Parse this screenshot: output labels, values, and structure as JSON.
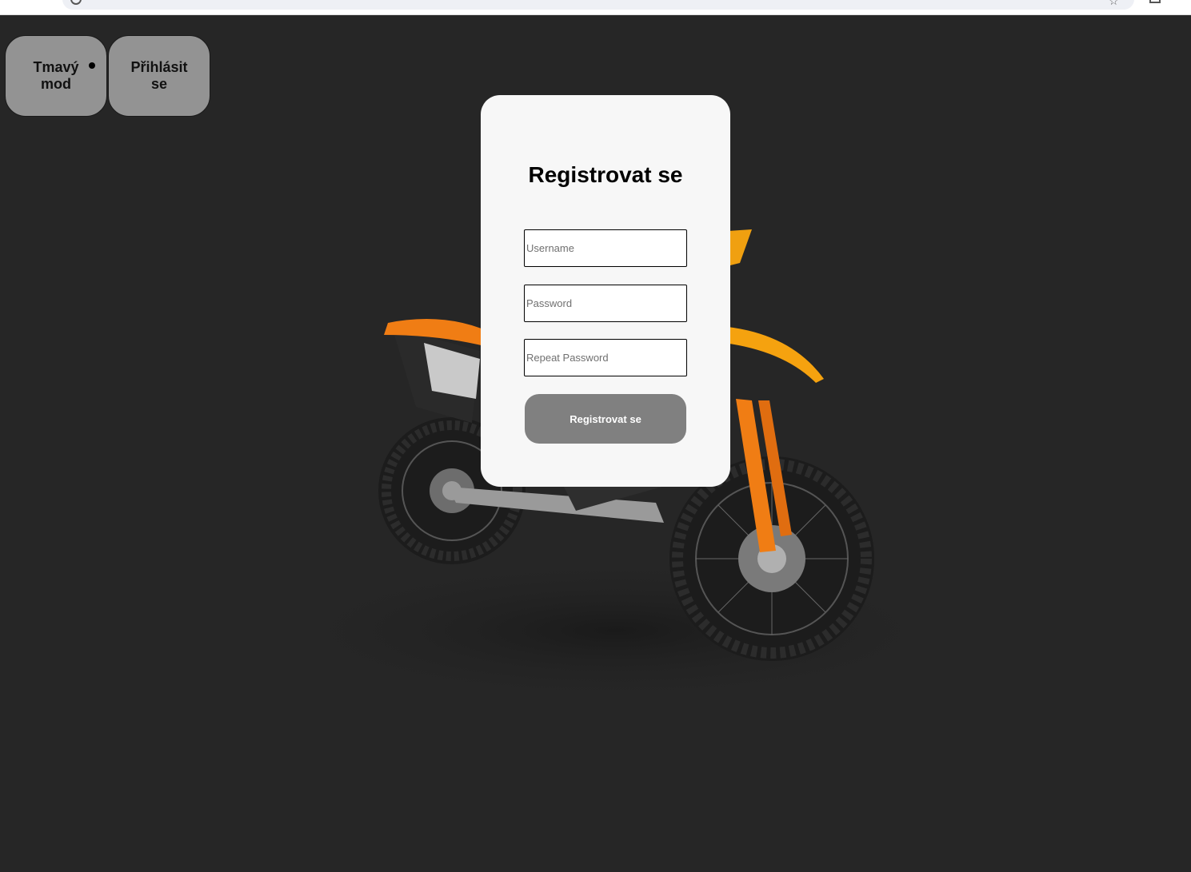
{
  "toolbar": {
    "dark_mode_label_line1": "Tmavý",
    "dark_mode_label_line2": "mod",
    "login_label_line1": "Přihlásit",
    "login_label_line2": "se"
  },
  "form": {
    "title": "Registrovat se",
    "username_placeholder": "Username",
    "password_placeholder": "Password",
    "repeat_password_placeholder": "Repeat Password",
    "submit_label": "Registrovat se"
  },
  "colors": {
    "background": "#262626",
    "card": "#f7f7f7",
    "button": "#939393",
    "submit": "#808080",
    "accent_orange": "#f07d14"
  }
}
